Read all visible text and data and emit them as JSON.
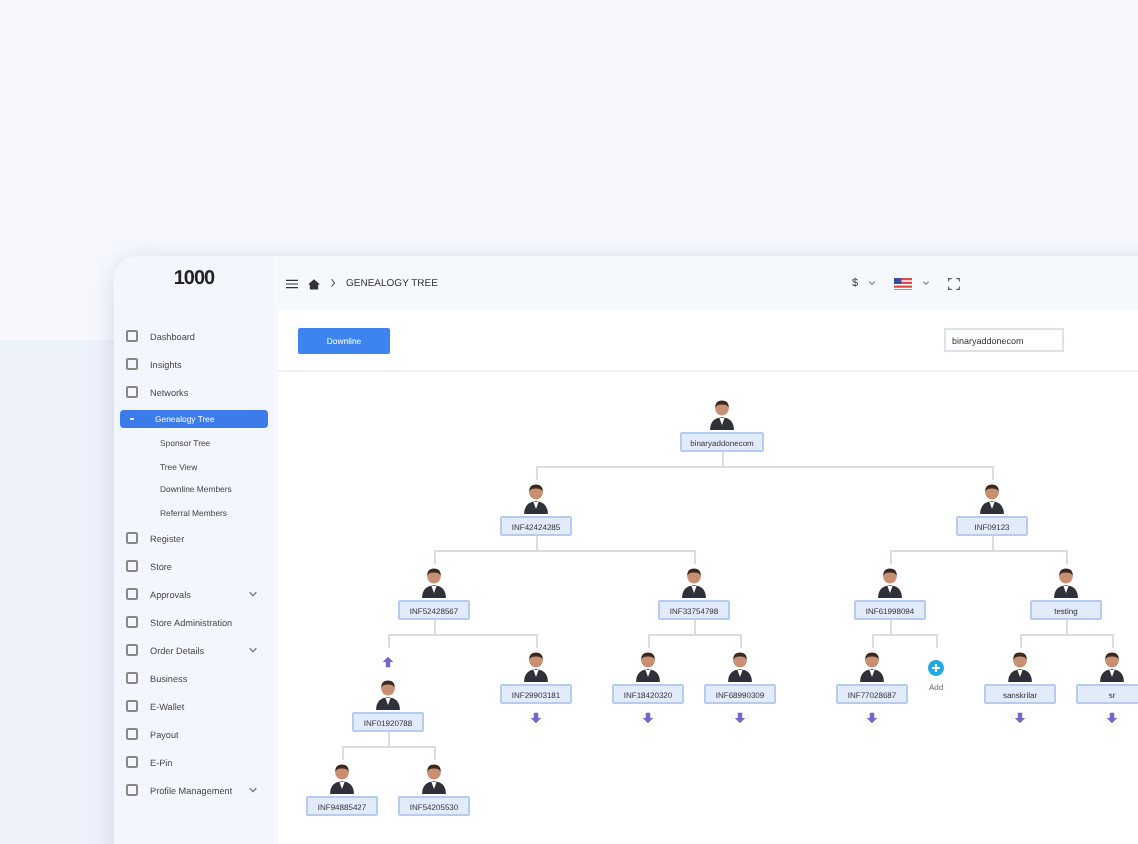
{
  "logo": {
    "text": "1000"
  },
  "sidebar": {
    "items": [
      {
        "label": "Dashboard",
        "expandable": false,
        "selected": false
      },
      {
        "label": "Insights",
        "expandable": false,
        "selected": false
      },
      {
        "label": "Networks",
        "expandable": false,
        "selected": false,
        "children": [
          {
            "label": "Genealogy Tree",
            "selected": true
          },
          {
            "label": "Sponsor Tree",
            "selected": false
          },
          {
            "label": "Tree View",
            "selected": false
          },
          {
            "label": "Downline Members",
            "selected": false
          },
          {
            "label": "Referral Members",
            "selected": false
          }
        ]
      },
      {
        "label": "Register",
        "expandable": false,
        "selected": false
      },
      {
        "label": "Store",
        "expandable": false,
        "selected": false
      },
      {
        "label": "Approvals",
        "expandable": true,
        "selected": false
      },
      {
        "label": "Store Administration",
        "expandable": false,
        "selected": false
      },
      {
        "label": "Order Details",
        "expandable": true,
        "selected": false
      },
      {
        "label": "Business",
        "expandable": false,
        "selected": false
      },
      {
        "label": "E-Wallet",
        "expandable": false,
        "selected": false
      },
      {
        "label": "Payout",
        "expandable": false,
        "selected": false
      },
      {
        "label": "E-Pin",
        "expandable": false,
        "selected": false
      },
      {
        "label": "Profile Management",
        "expandable": true,
        "selected": false
      }
    ]
  },
  "header": {
    "breadcrumb": "GENEALOGY TREE",
    "currency": "$"
  },
  "toolbar": {
    "button": "Downline",
    "search": {
      "value": "binaryaddonecom"
    }
  },
  "tree": {
    "kind": "member",
    "label": "binaryaddonecom",
    "children": [
      {
        "kind": "member",
        "label": "INF42424285",
        "children": [
          {
            "kind": "member",
            "label": "INF52428567",
            "children": [
              {
                "kind": "member",
                "label": "INF01920788",
                "arrow_above": true,
                "children": [
                  {
                    "kind": "member",
                    "label": "INF94885427"
                  },
                  {
                    "kind": "member",
                    "label": "INF54205530"
                  }
                ]
              },
              {
                "kind": "member",
                "label": "INF29903181",
                "more_below": true
              }
            ]
          },
          {
            "kind": "member",
            "label": "INF33754798",
            "children": [
              {
                "kind": "member",
                "label": "INF18420320",
                "more_below": true
              },
              {
                "kind": "member",
                "label": "INF68990309",
                "more_below": true
              }
            ]
          }
        ]
      },
      {
        "kind": "member",
        "label": "INF09123",
        "children": [
          {
            "kind": "member",
            "label": "INF61998094",
            "children": [
              {
                "kind": "member",
                "label": "INF77028687",
                "more_below": true
              },
              {
                "kind": "add",
                "label": "Add"
              }
            ]
          },
          {
            "kind": "member",
            "label": "testing",
            "children": [
              {
                "kind": "member",
                "label": "sanskrilar",
                "more_below": true
              },
              {
                "kind": "member",
                "label": "sr",
                "more_below": true
              }
            ]
          }
        ]
      }
    ]
  }
}
